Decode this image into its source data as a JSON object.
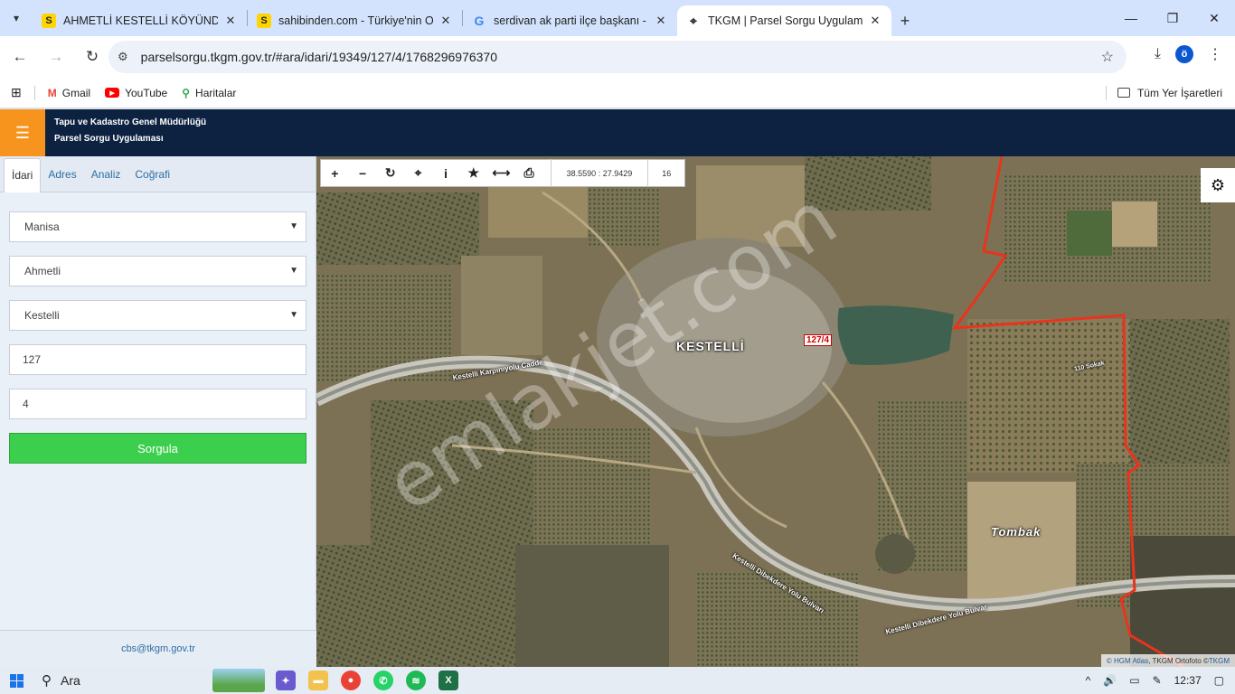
{
  "browser": {
    "tabs": [
      {
        "title": "AHMETLİ KESTELLİ KÖYÜNDE S",
        "favicon": "S",
        "icon": "sahibinden-icon",
        "active": false
      },
      {
        "title": "sahibinden.com - Türkiye'nin O",
        "favicon": "S",
        "icon": "sahibinden-icon",
        "active": false
      },
      {
        "title": "serdivan ak parti ilçe başkanı - ",
        "favicon": "G",
        "icon": "google-icon",
        "active": false
      },
      {
        "title": "TKGM | Parsel Sorgu Uygulama",
        "favicon": "⌖",
        "icon": "map-pin-icon",
        "active": true
      }
    ],
    "new_tab_glyph": "+",
    "url": "parselsorgu.tkgm.gov.tr/#ara/idari/19349/127/4/1768296976370",
    "profile_initial": "ö",
    "bookmarks": [
      {
        "label": "Gmail",
        "icon": "gmail-icon"
      },
      {
        "label": "YouTube",
        "icon": "youtube-icon"
      },
      {
        "label": "Haritalar",
        "icon": "maps-icon"
      }
    ],
    "all_bookmarks_label": "Tüm Yer İşaretleri"
  },
  "app": {
    "org_name": "Tapu ve Kadastro Genel Müdürlüğü",
    "app_name": "Parsel Sorgu Uygulaması",
    "tabs": [
      "İdari",
      "Adres",
      "Analiz",
      "Coğrafi"
    ],
    "active_tab": "İdari",
    "form": {
      "province": "Manisa",
      "district": "Ahmetli",
      "neighborhood": "Kestelli",
      "block": "127",
      "parcel": "4",
      "query_label": "Sorgula"
    },
    "contact_email": "cbs@tkgm.gov.tr"
  },
  "map": {
    "coordinates": "38.5590 : 27.9429",
    "zoom": "16",
    "toolbar_icons": [
      "zoom-in-icon",
      "zoom-out-icon",
      "refresh-icon",
      "locate-icon",
      "info-icon",
      "bookmark-star-icon",
      "measure-icon",
      "print-icon"
    ],
    "labels": {
      "village": "KESTELLİ",
      "parcel": "127/4",
      "place": "Tombak",
      "road_1": "Kestelli Karpınıyolu Cadde",
      "road_2": "Kestelli Dibekdere Yolu Bulvarı",
      "road_3": "Kestelli Dibekdere Yolu Bulvar",
      "street_1": "110 Sokak",
      "watermark": "emlakjet.com"
    },
    "attribution": {
      "source_1": "© HGM Atlas",
      "source_2": ", TKGM Ortofoto © ",
      "source_3": "TKGM"
    },
    "colors": {
      "parcel_border": "#e8341c",
      "header": "#0d2140",
      "menu_button": "#f7941d",
      "query_button": "#3ccf4e"
    }
  },
  "taskbar": {
    "search_label": "Ara",
    "time": "12:37"
  }
}
